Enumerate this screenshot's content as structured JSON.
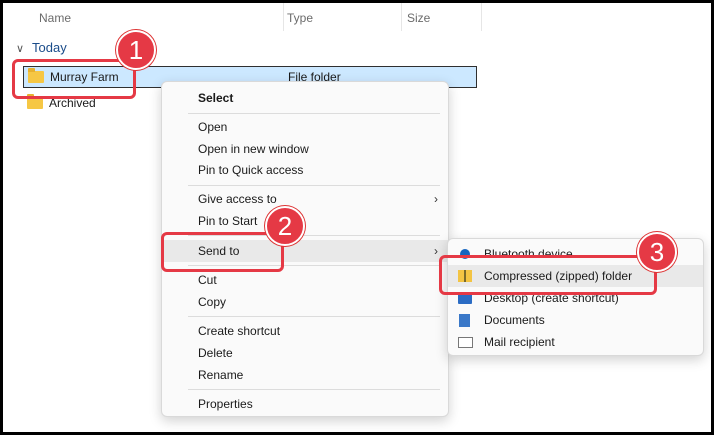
{
  "columns": {
    "name": "Name",
    "type": "Type",
    "size": "Size"
  },
  "group": {
    "label": "Today"
  },
  "files": [
    {
      "name": "Murray Farm",
      "type": "File folder"
    },
    {
      "name": "Archived",
      "type": ""
    }
  ],
  "context_menu": {
    "select": "Select",
    "open": "Open",
    "open_new_window": "Open in new window",
    "pin_quick_access": "Pin to Quick access",
    "give_access": "Give access to",
    "pin_start": "Pin to Start",
    "send_to": "Send to",
    "cut": "Cut",
    "copy": "Copy",
    "create_shortcut": "Create shortcut",
    "delete": "Delete",
    "rename": "Rename",
    "properties": "Properties",
    "arrow": "›"
  },
  "send_to_menu": {
    "bluetooth": "Bluetooth device",
    "compressed": "Compressed (zipped) folder",
    "desktop": "Desktop (create shortcut)",
    "documents": "Documents",
    "mail": "Mail recipient"
  },
  "steps": [
    "1",
    "2",
    "3"
  ],
  "colors": {
    "callout": "#e53945",
    "selection": "#cce8ff"
  }
}
